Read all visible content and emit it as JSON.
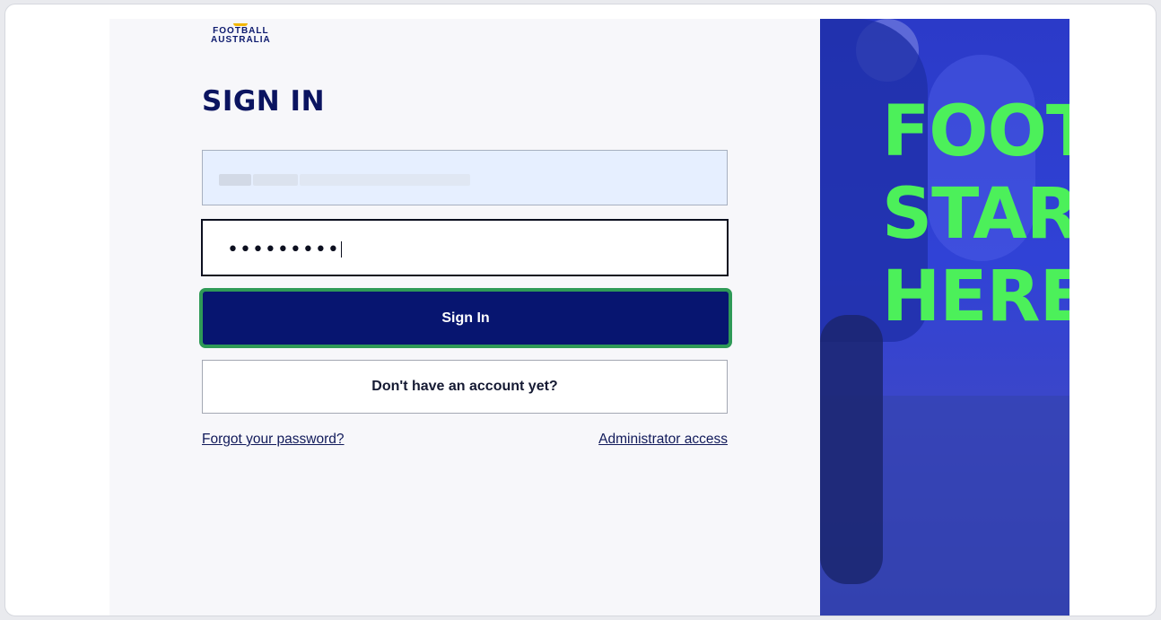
{
  "brand": {
    "logo_line1": "FOOTBALL",
    "logo_line2": "AUSTRALIA"
  },
  "form": {
    "title": "SIGN IN",
    "email_value": "",
    "password_masked": "•••••••••",
    "signin_label": "Sign In",
    "create_account_label": "Don't have an account yet?",
    "forgot_label": "Forgot your password?",
    "admin_label": "Administrator access"
  },
  "hero": {
    "line1": "FOOT",
    "line2": "STAR",
    "line3": "HERE"
  },
  "colors": {
    "primary_navy": "#071570",
    "focus_green": "#2f9a57",
    "hero_blue": "#3042d6",
    "slogan_green": "#4cf05a"
  }
}
